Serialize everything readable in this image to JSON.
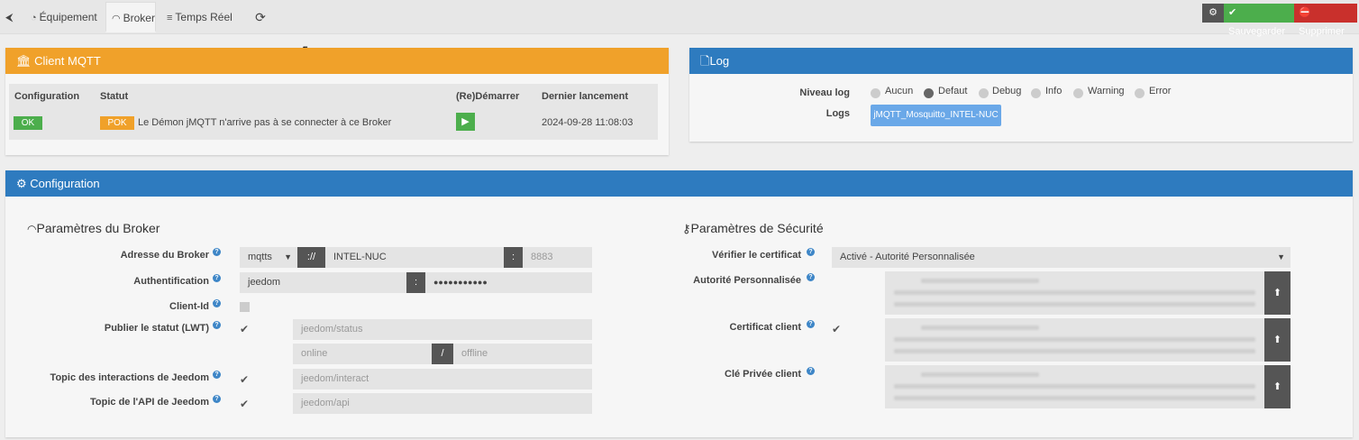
{
  "tabs": [
    {
      "label": "Équipement",
      "icon": "dashboard-icon"
    },
    {
      "label": "Broker",
      "icon": "rss-icon"
    },
    {
      "label": "Temps Réel",
      "icon": "list-icon"
    }
  ],
  "toolbar": {
    "save_label": "Sauvegarder",
    "delete_label": "Supprimer"
  },
  "client_mqtt": {
    "title": "Client MQTT",
    "headers": {
      "configuration": "Configuration",
      "statut": "Statut",
      "restart": "(Re)Démarrer",
      "last_launch": "Dernier lancement"
    },
    "config_badge": "OK",
    "status_badge": "POK",
    "status_text": "Le Démon jMQTT n'arrive pas à se connecter à ce Broker",
    "last_launch": "2024-09-28 11:08:03",
    "colors": {
      "header": "#f0a12a",
      "ok": "#4cae4c",
      "pok": "#f0a12a"
    }
  },
  "log": {
    "title": "Log",
    "level_label": "Niveau log",
    "levels": [
      "Aucun",
      "Defaut",
      "Debug",
      "Info",
      "Warning",
      "Error"
    ],
    "selected_level": "Defaut",
    "logs_label": "Logs",
    "log_button": "jMQTT_Mosquitto_INTEL-NUC",
    "colors": {
      "header": "#2e7bbf",
      "button": "#6aa8e8"
    }
  },
  "configuration": {
    "title": "Configuration",
    "broker": {
      "title": "Paramètres du Broker",
      "address_label": "Adresse du Broker",
      "protocol": "mqtts",
      "separator": "://",
      "host": "INTEL-NUC",
      "port_sep": ":",
      "port_placeholder": "8883",
      "auth_label": "Authentification",
      "user": "jeedom",
      "auth_sep": ":",
      "password": "●●●●●●●●●●●",
      "client_id_label": "Client-Id",
      "lwt_label": "Publier le statut (LWT)",
      "lwt_topic_placeholder": "jeedom/status",
      "lwt_online_placeholder": "online",
      "lwt_sep": "/",
      "lwt_offline_placeholder": "offline",
      "interact_label": "Topic des interactions de Jeedom",
      "interact_placeholder": "jeedom/interact",
      "api_label": "Topic de l'API de Jeedom",
      "api_placeholder": "jeedom/api"
    },
    "security": {
      "title": "Paramètres de Sécurité",
      "verify_label": "Vérifier le certificat",
      "verify_value": "Activé - Autorité Personnalisée",
      "authority_label": "Autorité Personnalisée",
      "client_cert_label": "Certificat client",
      "private_key_label": "Clé Privée client"
    }
  }
}
